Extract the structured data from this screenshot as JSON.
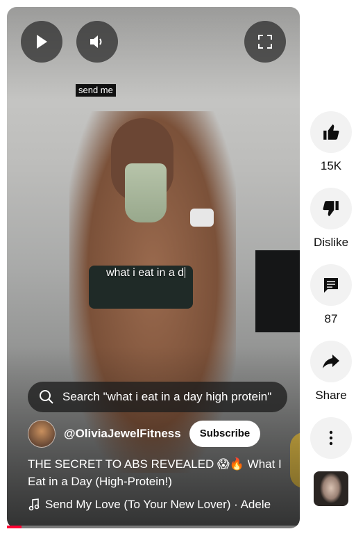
{
  "player": {
    "tooltip": "send me",
    "caption": "what i eat in a d",
    "search_suggestion": "Search \"what i eat in a day high protein\"",
    "channel": "@OliviaJewelFitness",
    "subscribe_label": "Subscribe",
    "title": "THE SECRET TO ABS REVEALED 😱🔥 What I Eat in a Day (High-Protein!)",
    "music": "Send My Love (To Your New Lover) · Adele",
    "progress": 0.05
  },
  "actions": {
    "like_count": "15K",
    "dislike_label": "Dislike",
    "comment_count": "87",
    "share_label": "Share"
  },
  "colors": {
    "accent": "#ff0033",
    "action_bg": "#f2f2f2"
  },
  "icons": [
    "play-icon",
    "volume-icon",
    "fullscreen-icon",
    "search-icon",
    "music-note-icon",
    "thumbs-up-icon",
    "thumbs-down-icon",
    "comment-icon",
    "share-icon",
    "more-icon"
  ]
}
